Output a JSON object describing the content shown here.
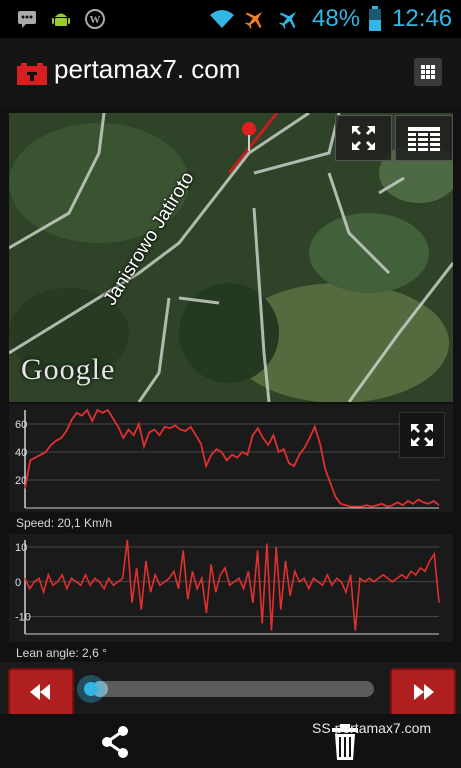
{
  "status_bar": {
    "icons": [
      "bbm-icon",
      "android-icon",
      "wordpress-icon",
      "wifi-icon",
      "airplane-mode-icon",
      "airplane-mode-icon",
      "battery-icon"
    ],
    "battery_percent": "48%",
    "time": "12:46"
  },
  "app": {
    "title": "pertamax7. com",
    "logo": "battery-logo-icon",
    "menu": "grid-menu-icon"
  },
  "map": {
    "road_label": "Janisrowo Jatiroto",
    "attribution": "Google",
    "buttons": [
      "fullscreen-icon",
      "table-icon"
    ]
  },
  "speed": {
    "label": "Speed: 20,1  Km/h"
  },
  "lean": {
    "label": "Lean angle: 2,6 °"
  },
  "playback": {
    "progress": 0.03
  },
  "bottom": {
    "watermark": "SS pertamax7.com"
  },
  "colors": {
    "accent": "#33b5e5",
    "line": "#e03030",
    "button": "#b02020"
  },
  "chart_data": [
    {
      "type": "line",
      "title": "",
      "ylabel": "",
      "ylim": [
        0,
        70
      ],
      "yticks": [
        20,
        40,
        60
      ],
      "x": [
        0,
        1,
        2,
        3,
        4,
        5,
        6,
        7,
        8,
        9,
        10,
        11,
        12,
        13,
        14,
        15,
        16,
        17,
        18,
        19,
        20,
        21,
        22,
        23,
        24,
        25,
        26,
        27,
        28,
        29,
        30,
        31,
        32,
        33,
        34,
        35,
        36,
        37,
        38,
        39,
        40,
        41,
        42,
        43,
        44,
        45,
        46,
        47,
        48,
        49,
        50,
        51,
        52,
        53,
        54,
        55,
        56,
        57,
        58,
        59,
        60,
        61,
        62,
        63,
        64,
        65,
        66,
        67,
        68,
        69,
        70,
        71,
        72,
        73,
        74,
        75,
        76,
        77,
        78,
        79,
        80
      ],
      "series": [
        {
          "values": [
            14,
            34,
            36,
            38,
            40,
            45,
            48,
            50,
            55,
            63,
            68,
            66,
            70,
            62,
            70,
            68,
            70,
            64,
            58,
            50,
            56,
            52,
            60,
            44,
            54,
            56,
            52,
            58,
            57,
            59,
            56,
            55,
            58,
            52,
            46,
            30,
            38,
            42,
            40,
            34,
            38,
            36,
            40,
            38,
            52,
            57,
            50,
            45,
            52,
            40,
            42,
            32,
            30,
            38,
            43,
            50,
            58,
            46,
            28,
            18,
            8,
            3,
            2,
            1,
            1,
            1,
            2,
            1,
            2,
            3,
            1,
            2,
            4,
            2,
            5,
            3,
            6,
            4,
            3,
            5,
            2
          ]
        }
      ]
    },
    {
      "type": "line",
      "title": "",
      "ylabel": "",
      "ylim": [
        -15,
        12
      ],
      "yticks": [
        10,
        0,
        -10
      ],
      "x": [
        0,
        1,
        2,
        3,
        4,
        5,
        6,
        7,
        8,
        9,
        10,
        11,
        12,
        13,
        14,
        15,
        16,
        17,
        18,
        19,
        20,
        21,
        22,
        23,
        24,
        25,
        26,
        27,
        28,
        29,
        30,
        31,
        32,
        33,
        34,
        35,
        36,
        37,
        38,
        39,
        40,
        41,
        42,
        43,
        44,
        45,
        46,
        47,
        48,
        49,
        50,
        51,
        52,
        53,
        54,
        55,
        56,
        57,
        58,
        59,
        60,
        61,
        62,
        63,
        64,
        65,
        66,
        67,
        68,
        69,
        70,
        71,
        72,
        73,
        74,
        75,
        76,
        77,
        78,
        79,
        80,
        81,
        82,
        83,
        84,
        85,
        86,
        87,
        88,
        89
      ],
      "series": [
        {
          "values": [
            1,
            -2,
            0,
            1,
            -3,
            2,
            -1,
            0,
            2,
            -2,
            1,
            0,
            -1,
            2,
            -1,
            1,
            0,
            -2,
            1,
            -1,
            0,
            1,
            12,
            -6,
            4,
            -8,
            6,
            -3,
            2,
            -1,
            0,
            1,
            3,
            -2,
            9,
            -5,
            3,
            -2,
            1,
            -9,
            5,
            -3,
            2,
            4,
            -1,
            0,
            1,
            -2,
            3,
            -6,
            9,
            -12,
            11,
            -14,
            10,
            -8,
            6,
            -4,
            3,
            0,
            1,
            -2,
            1,
            0,
            -1,
            2,
            -1,
            1,
            0,
            -3,
            2,
            -14,
            1,
            0,
            1,
            0,
            1,
            2,
            1,
            0,
            1,
            2,
            1,
            3,
            2,
            4,
            3,
            6,
            8,
            -6,
            4,
            7
          ]
        }
      ]
    }
  ]
}
